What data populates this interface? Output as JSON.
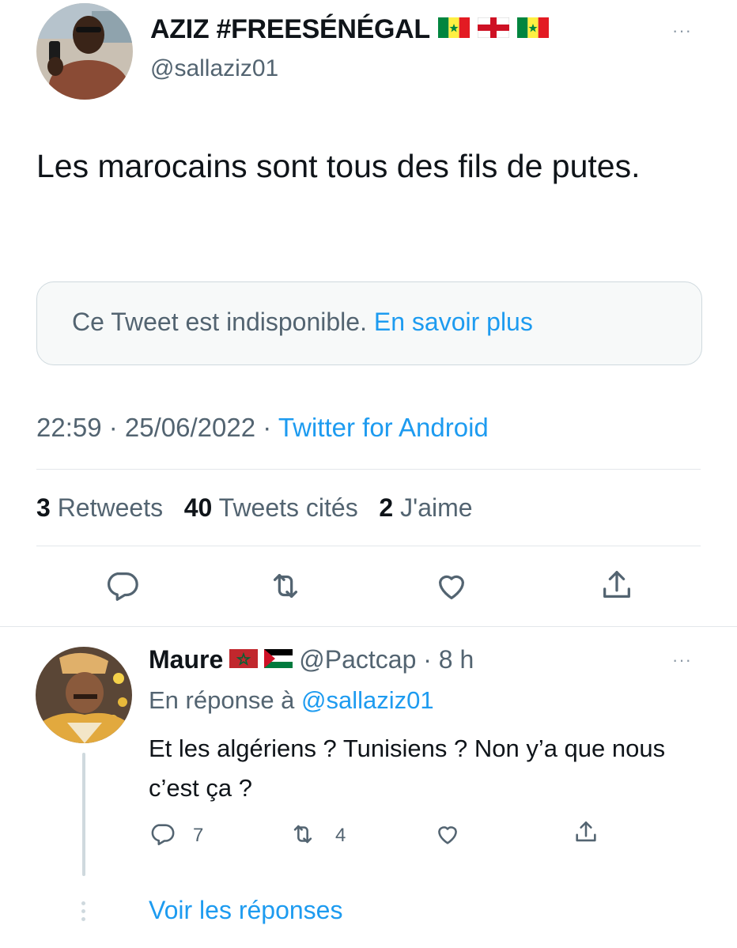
{
  "tweet": {
    "author_name": "AZIZ #FREESÉNÉGAL",
    "author_flags": [
      "senegal-flag",
      "england-flag",
      "senegal-flag"
    ],
    "author_handle": "@sallaziz01",
    "more_label": "···",
    "text": "Les marocains sont tous des fils de putes.",
    "quote_unavailable": "Ce Tweet est indisponible.",
    "quote_link": "En savoir plus",
    "timestamp": "22:59 · 25/06/2022 ·",
    "source": "Twitter for Android",
    "stats": {
      "retweets_count": "3",
      "retweets_label": "Retweets",
      "quotes_count": "40",
      "quotes_label": "Tweets cités",
      "likes_count": "2",
      "likes_label": "J'aime"
    },
    "actions": [
      "reply-icon",
      "retweet-icon",
      "like-icon",
      "share-icon"
    ]
  },
  "reply": {
    "author_name": "Maure",
    "author_flags": [
      "morocco-flag",
      "palestine-flag"
    ],
    "author_handle": "@Pactcap · 8 h",
    "more_label": "···",
    "in_reply_prefix": "En réponse à",
    "in_reply_handle": "@sallaziz01",
    "text": "Et les algériens ? Tunisiens ? Non y’a que nous c’est ça ?",
    "reply_count": "7",
    "retweet_count": "4"
  },
  "show_replies": "Voir les réponses",
  "colors": {
    "link": "#1d9bf0",
    "secondary": "#536471",
    "primary": "#0f1419",
    "border": "#cfd9de"
  }
}
